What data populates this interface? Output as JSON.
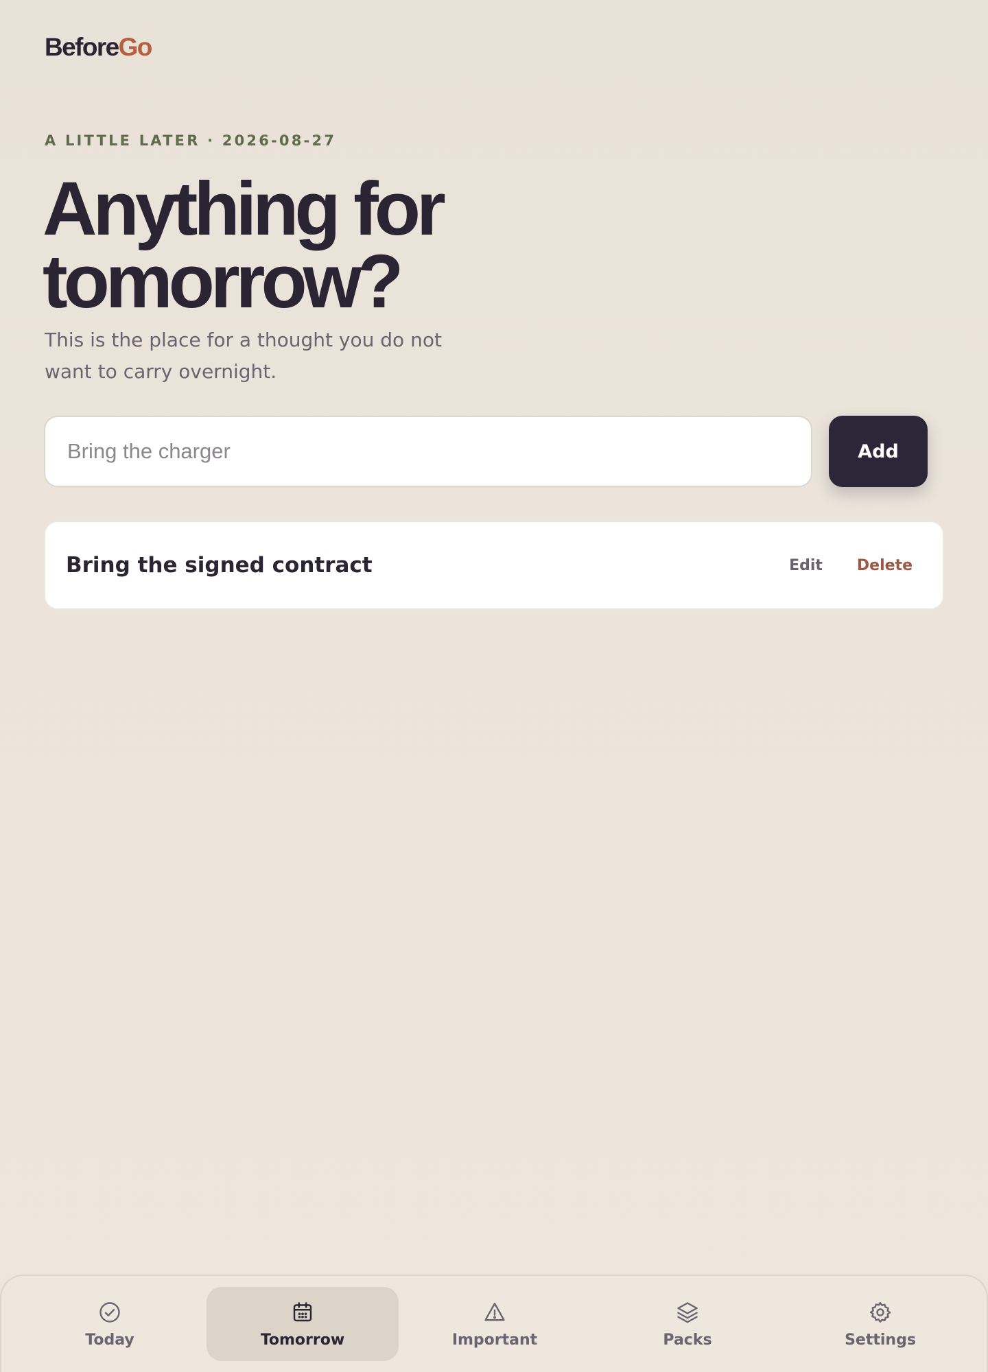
{
  "brand": {
    "name_part1": "Before",
    "name_part2": "Go",
    "accent_color": "#b5603e"
  },
  "header": {
    "eyebrow": "A LITTLE LATER · 2026-08-27",
    "title_line1": "Anything for",
    "title_line2": "tomorrow?",
    "subtitle": "This is the place for a thought you do not want to carry overnight."
  },
  "composer": {
    "placeholder": "Bring the charger",
    "value": "",
    "add_label": "Add"
  },
  "items": [
    {
      "text": "Bring the signed contract",
      "edit_label": "Edit",
      "delete_label": "Delete"
    }
  ],
  "nav": {
    "active": "Tomorrow",
    "items": [
      {
        "label": "Today",
        "icon": "check-circle-icon"
      },
      {
        "label": "Tomorrow",
        "icon": "calendar-icon"
      },
      {
        "label": "Important",
        "icon": "warning-icon"
      },
      {
        "label": "Packs",
        "icon": "layers-icon"
      },
      {
        "label": "Settings",
        "icon": "gear-icon"
      }
    ]
  },
  "colors": {
    "background": "#ebe3d9",
    "ink": "#2b2433",
    "eyebrow": "#606b4d",
    "delete": "#9b5a45",
    "button": "#2d2638"
  }
}
